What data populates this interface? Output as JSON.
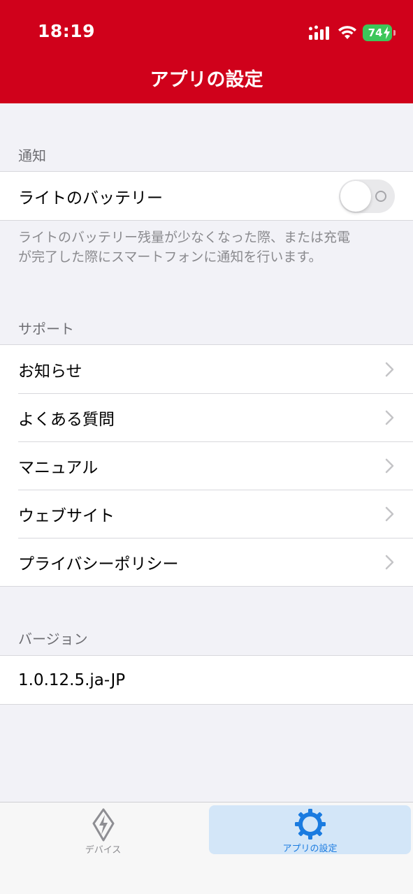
{
  "status_bar": {
    "time": "18:19",
    "battery": "74"
  },
  "header": {
    "title": "アプリの設定",
    "background": "#d0011b"
  },
  "notifications": {
    "section_title": "通知",
    "toggle_label": "ライトのバッテリー",
    "toggle_on": false,
    "description": "ライトのバッテリー残量が少なくなった際、または充電が完了した際にスマートフォンに通知を行います。"
  },
  "support": {
    "section_title": "サポート",
    "items": [
      {
        "label": "お知らせ"
      },
      {
        "label": "よくある質問"
      },
      {
        "label": "マニュアル"
      },
      {
        "label": "ウェブサイト"
      },
      {
        "label": "プライバシーポリシー"
      }
    ]
  },
  "version": {
    "section_title": "バージョン",
    "value": "1.0.12.5.ja-JP"
  },
  "tabbar": {
    "tabs": [
      {
        "label": "デバイス",
        "icon": "device-icon",
        "active": false
      },
      {
        "label": "アプリの設定",
        "icon": "gear-icon",
        "active": true
      }
    ],
    "active_color": "#1a7be0"
  }
}
